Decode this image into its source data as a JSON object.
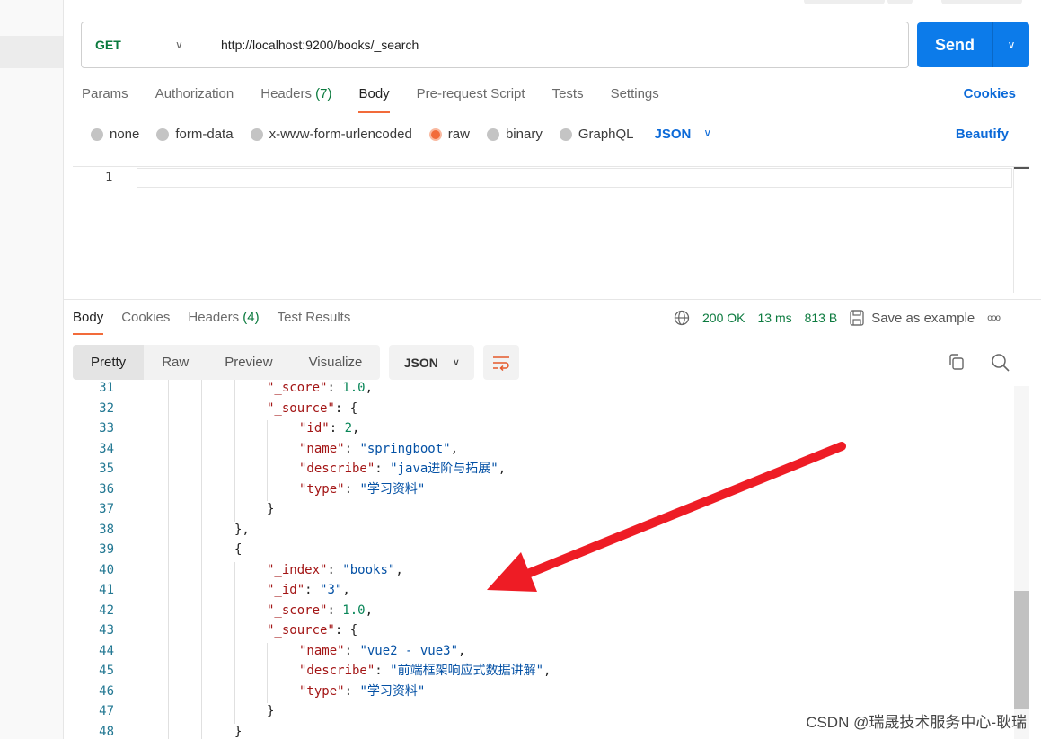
{
  "request": {
    "method": "GET",
    "url": "http://localhost:9200/books/_search",
    "send_label": "Send"
  },
  "tabs": [
    {
      "label": "Params"
    },
    {
      "label": "Authorization"
    },
    {
      "label": "Headers",
      "count": "(7)"
    },
    {
      "label": "Body",
      "active": true
    },
    {
      "label": "Pre-request Script"
    },
    {
      "label": "Tests"
    },
    {
      "label": "Settings"
    }
  ],
  "cookies_label": "Cookies",
  "body_types": [
    {
      "label": "none"
    },
    {
      "label": "form-data"
    },
    {
      "label": "x-www-form-urlencoded"
    },
    {
      "label": "raw",
      "selected": true
    },
    {
      "label": "binary"
    },
    {
      "label": "GraphQL"
    }
  ],
  "body_format": "JSON",
  "beautify_label": "Beautify",
  "editor": {
    "line_number": "1"
  },
  "response": {
    "tabs": [
      {
        "label": "Body",
        "active": true
      },
      {
        "label": "Cookies"
      },
      {
        "label": "Headers",
        "count": "(4)"
      },
      {
        "label": "Test Results"
      }
    ],
    "status": "200 OK",
    "time": "13 ms",
    "size": "813 B",
    "save_label": "Save as example",
    "more": "ooo",
    "views": [
      "Pretty",
      "Raw",
      "Preview",
      "Visualize"
    ],
    "format": "JSON",
    "lines": [
      {
        "n": "31",
        "i": 4,
        "parts": [
          [
            "k",
            "\"_score\""
          ],
          [
            "p",
            ": "
          ],
          [
            "num",
            "1.0"
          ],
          [
            "p",
            ","
          ]
        ]
      },
      {
        "n": "32",
        "i": 4,
        "parts": [
          [
            "k",
            "\"_source\""
          ],
          [
            "p",
            ": {"
          ]
        ]
      },
      {
        "n": "33",
        "i": 5,
        "parts": [
          [
            "k",
            "\"id\""
          ],
          [
            "p",
            ": "
          ],
          [
            "num",
            "2"
          ],
          [
            "p",
            ","
          ]
        ]
      },
      {
        "n": "34",
        "i": 5,
        "parts": [
          [
            "k",
            "\"name\""
          ],
          [
            "p",
            ": "
          ],
          [
            "s",
            "\"springboot\""
          ],
          [
            "p",
            ","
          ]
        ]
      },
      {
        "n": "35",
        "i": 5,
        "parts": [
          [
            "k",
            "\"describe\""
          ],
          [
            "p",
            ": "
          ],
          [
            "s",
            "\"java进阶与拓展\""
          ],
          [
            "p",
            ","
          ]
        ]
      },
      {
        "n": "36",
        "i": 5,
        "parts": [
          [
            "k",
            "\"type\""
          ],
          [
            "p",
            ": "
          ],
          [
            "s",
            "\"学习资料\""
          ]
        ]
      },
      {
        "n": "37",
        "i": 4,
        "parts": [
          [
            "p",
            "}"
          ]
        ]
      },
      {
        "n": "38",
        "i": 3,
        "parts": [
          [
            "p",
            "},"
          ]
        ]
      },
      {
        "n": "39",
        "i": 3,
        "parts": [
          [
            "p",
            "{"
          ]
        ]
      },
      {
        "n": "40",
        "i": 4,
        "parts": [
          [
            "k",
            "\"_index\""
          ],
          [
            "p",
            ": "
          ],
          [
            "s",
            "\"books\""
          ],
          [
            "p",
            ","
          ]
        ]
      },
      {
        "n": "41",
        "i": 4,
        "parts": [
          [
            "k",
            "\"_id\""
          ],
          [
            "p",
            ": "
          ],
          [
            "s",
            "\"3\""
          ],
          [
            "p",
            ","
          ]
        ]
      },
      {
        "n": "42",
        "i": 4,
        "parts": [
          [
            "k",
            "\"_score\""
          ],
          [
            "p",
            ": "
          ],
          [
            "num",
            "1.0"
          ],
          [
            "p",
            ","
          ]
        ]
      },
      {
        "n": "43",
        "i": 4,
        "parts": [
          [
            "k",
            "\"_source\""
          ],
          [
            "p",
            ": {"
          ]
        ]
      },
      {
        "n": "44",
        "i": 5,
        "parts": [
          [
            "k",
            "\"name\""
          ],
          [
            "p",
            ": "
          ],
          [
            "s",
            "\"vue2 - vue3\""
          ],
          [
            "p",
            ","
          ]
        ]
      },
      {
        "n": "45",
        "i": 5,
        "parts": [
          [
            "k",
            "\"describe\""
          ],
          [
            "p",
            ": "
          ],
          [
            "s",
            "\"前端框架响应式数据讲解\""
          ],
          [
            "p",
            ","
          ]
        ]
      },
      {
        "n": "46",
        "i": 5,
        "parts": [
          [
            "k",
            "\"type\""
          ],
          [
            "p",
            ": "
          ],
          [
            "s",
            "\"学习资料\""
          ]
        ]
      },
      {
        "n": "47",
        "i": 4,
        "parts": [
          [
            "p",
            "}"
          ]
        ]
      },
      {
        "n": "48",
        "i": 3,
        "parts": [
          [
            "p",
            "}"
          ]
        ]
      }
    ]
  },
  "annotation_color": "#ee1c25",
  "watermark": "CSDN @瑞晟技术服务中心-耿瑞"
}
